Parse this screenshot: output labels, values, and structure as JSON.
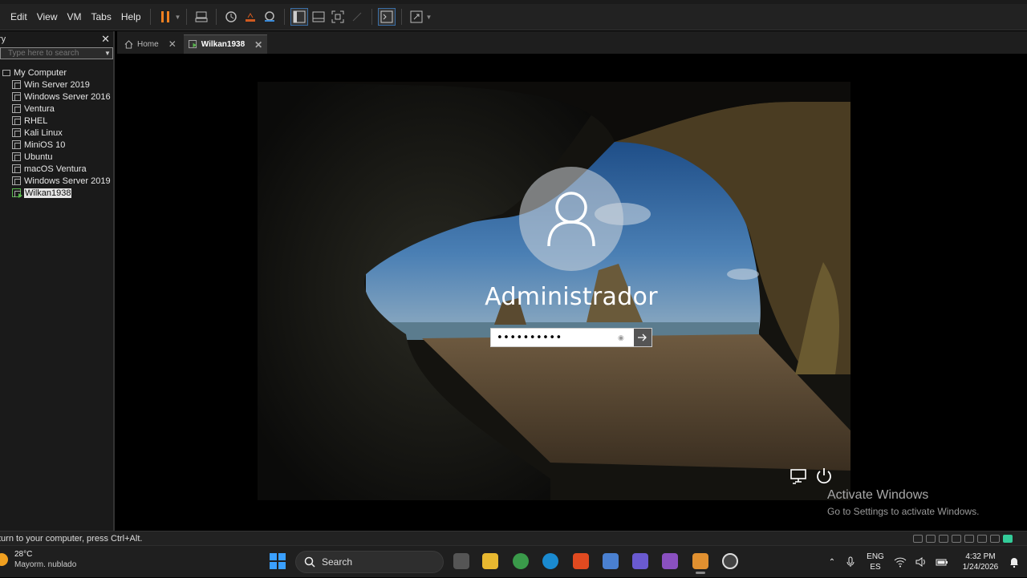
{
  "menu": [
    "Edit",
    "View",
    "VM",
    "Tabs",
    "Help"
  ],
  "library": {
    "title": "ry",
    "search_placeholder": "Type here to search",
    "root": "My Computer",
    "vms": [
      "Win Server 2019",
      "Windows Server 2016",
      "Ventura",
      "RHEL",
      "Kali Linux",
      "MiniOS 10",
      "Ubuntu",
      "macOS Ventura",
      "Windows Server 2019",
      "Wilkan1938"
    ],
    "selected_vm": "Wilkan1938"
  },
  "tabs": {
    "home": "Home",
    "vm": "Wilkan1938"
  },
  "login": {
    "username": "Administrador",
    "password_mask": "••••••••••"
  },
  "watermark": {
    "title": "Activate Windows",
    "subtitle": "Go to Settings to activate Windows."
  },
  "statusbar": {
    "message": "turn to your computer, press Ctrl+Alt."
  },
  "taskbar": {
    "temperature": "28°C",
    "weather": "Mayorm. nublado",
    "search_label": "Search",
    "lang1": "ENG",
    "lang2": "ES",
    "time": "4:32 PM",
    "date": "1/24/2026"
  },
  "colors": {
    "accent": "#3aa0ff",
    "vm_running": "#5ab84e",
    "toolbar_pause": "#f08020"
  }
}
